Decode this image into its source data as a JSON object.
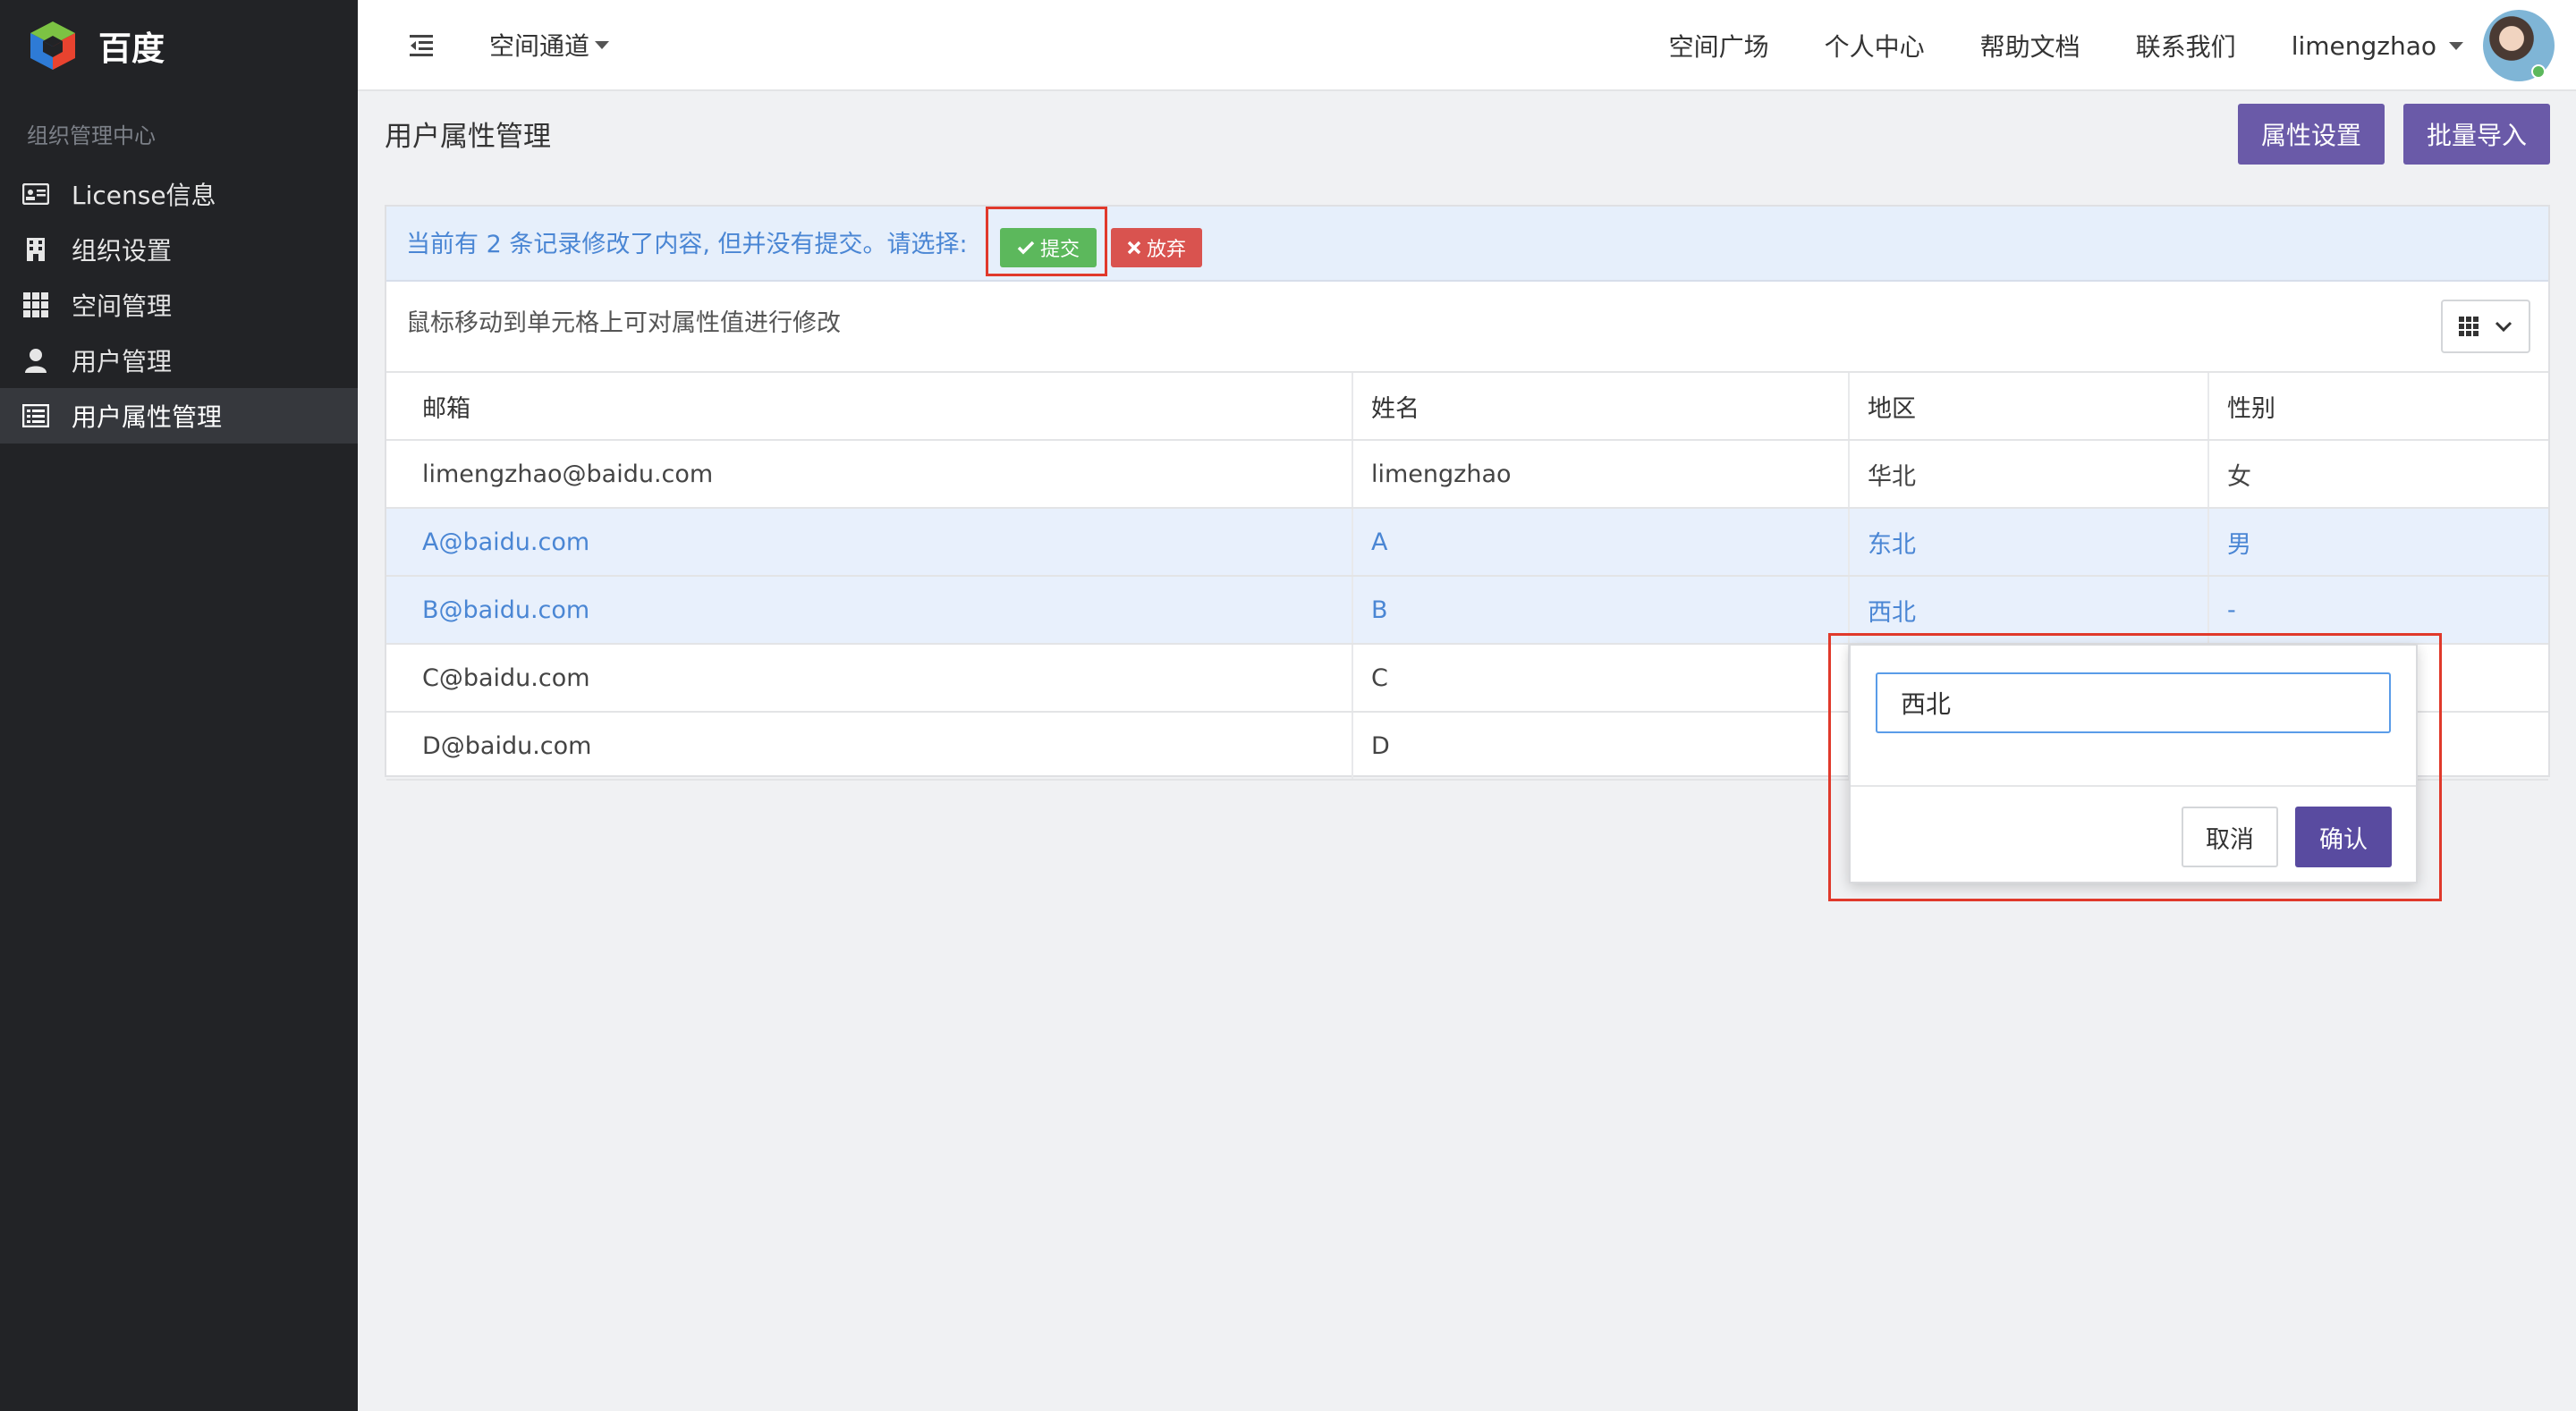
{
  "brand": {
    "name": "百度"
  },
  "sidebar": {
    "section": "组织管理中心",
    "items": [
      {
        "label": "License信息",
        "icon": "id-card-icon"
      },
      {
        "label": "组织设置",
        "icon": "building-icon"
      },
      {
        "label": "空间管理",
        "icon": "grid-icon"
      },
      {
        "label": "用户管理",
        "icon": "user-icon"
      },
      {
        "label": "用户属性管理",
        "icon": "list-icon",
        "active": true
      }
    ]
  },
  "topbar": {
    "channel": "空间通道",
    "links": [
      "空间广场",
      "个人中心",
      "帮助文档",
      "联系我们"
    ],
    "username": "limengzhao"
  },
  "page": {
    "title": "用户属性管理",
    "attr_settings": "属性设置",
    "batch_import": "批量导入"
  },
  "alert": {
    "message": "当前有 2 条记录修改了内容, 但并没有提交。请选择:",
    "submit": "提交",
    "discard": "放弃"
  },
  "hint": "鼠标移动到单元格上可对属性值进行修改",
  "table": {
    "headers": [
      "邮箱",
      "姓名",
      "地区",
      "性别"
    ],
    "rows": [
      {
        "email": "limengzhao@baidu.com",
        "name": "limengzhao",
        "region": "华北",
        "gender": "女",
        "modified": false
      },
      {
        "email": "A@baidu.com",
        "name": "A",
        "region": "东北",
        "gender": "男",
        "modified": true
      },
      {
        "email": "B@baidu.com",
        "name": "B",
        "region": "西北",
        "gender": "-",
        "modified": true
      },
      {
        "email": "C@baidu.com",
        "name": "C",
        "region": "",
        "gender": "",
        "modified": false
      },
      {
        "email": "D@baidu.com",
        "name": "D",
        "region": "",
        "gender": "",
        "modified": false
      }
    ]
  },
  "popover": {
    "value": "西北",
    "cancel": "取消",
    "confirm": "确认"
  },
  "colors": {
    "sidebar_bg": "#222326",
    "accent": "#6a5aa8",
    "modified_text": "#4a86d4",
    "highlight": "#e0392b"
  }
}
